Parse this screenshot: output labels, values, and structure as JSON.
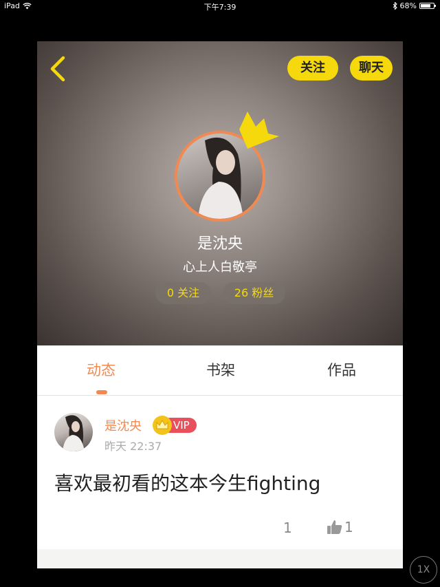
{
  "status_bar": {
    "device": "iPad",
    "time": "下午7:39",
    "battery": "68%"
  },
  "header": {
    "follow_button": "关注",
    "chat_button": "聊天",
    "user_name": "是沈央",
    "signature": "心上人白敬亭",
    "stats": {
      "following": "0 关注",
      "fans": "26 粉丝"
    }
  },
  "tabs": [
    {
      "label": "动态",
      "active": true
    },
    {
      "label": "书架",
      "active": false
    },
    {
      "label": "作品",
      "active": false
    }
  ],
  "post": {
    "user_name": "是沈央",
    "badge": "VIP",
    "time": "昨天 22:37",
    "text": "喜欢最初看的这本今生fighting",
    "reply_count": "1",
    "like_count": "1"
  },
  "speed_badge": "1X",
  "colors": {
    "accent": "#f08a52",
    "yellow": "#f5d90d",
    "vip": "#e8505b"
  }
}
